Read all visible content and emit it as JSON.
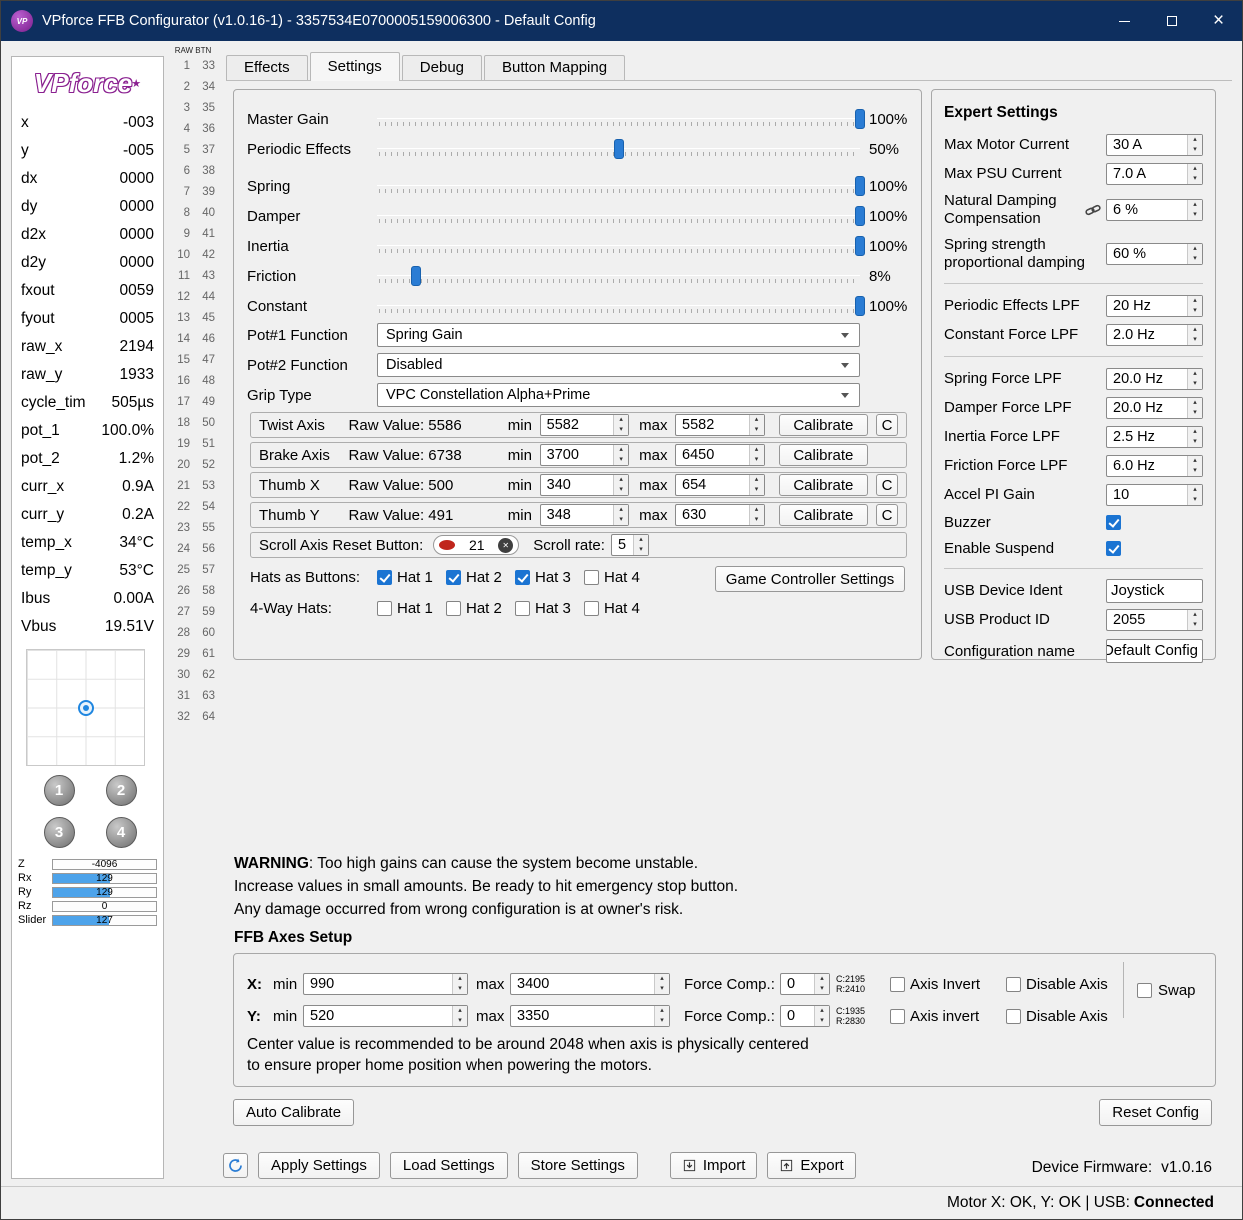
{
  "window": {
    "title": "VPforce FFB Configurator (v1.0.16-1) - 3357534E0700005159006300 - Default Config",
    "icon_text": "VP"
  },
  "colors": {
    "titlebar": "#0e2f5f",
    "accent": "#2a7cd4",
    "check": "#1b74d2",
    "barfill": "#4da3ea",
    "logo": "#8a2090",
    "red": "#c0251b"
  },
  "icons": {
    "close": "×",
    "star": "★",
    "clear": "✕",
    "spin_up": "▴",
    "spin_down": "▾"
  },
  "left_panel": {
    "logo_text": "VPforce",
    "telemetry": [
      {
        "label": "x",
        "value": "-003"
      },
      {
        "label": "y",
        "value": "-005"
      },
      {
        "label": "dx",
        "value": "0000"
      },
      {
        "label": "dy",
        "value": "0000"
      },
      {
        "label": "d2x",
        "value": "0000"
      },
      {
        "label": "d2y",
        "value": "0000"
      },
      {
        "label": "fxout",
        "value": "0059"
      },
      {
        "label": "fyout",
        "value": "0005"
      },
      {
        "label": "raw_x",
        "value": "2194"
      },
      {
        "label": "raw_y",
        "value": "1933"
      },
      {
        "label": "cycle_tim",
        "value": "505µs"
      },
      {
        "label": "pot_1",
        "value": "100.0%"
      },
      {
        "label": "pot_2",
        "value": "1.2%"
      },
      {
        "label": "curr_x",
        "value": "0.9A"
      },
      {
        "label": "curr_y",
        "value": "0.2A"
      },
      {
        "label": "temp_x",
        "value": "34°C"
      },
      {
        "label": "temp_y",
        "value": "53°C"
      },
      {
        "label": "Ibus",
        "value": "0.00A"
      },
      {
        "label": "Vbus",
        "value": "19.51V"
      }
    ],
    "stick_buttons": [
      "1",
      "2",
      "3",
      "4"
    ],
    "axis_bars": [
      {
        "label": "Z",
        "value": "-4096",
        "pct": 0
      },
      {
        "label": "Rx",
        "value": "129",
        "pct": 55
      },
      {
        "label": "Ry",
        "value": "129",
        "pct": 55
      },
      {
        "label": "Rz",
        "value": "0",
        "pct": 0
      },
      {
        "label": "Slider",
        "value": "127",
        "pct": 54
      }
    ]
  },
  "raw_btn": {
    "header": "RAW BTN",
    "rows": [
      {
        "l": "1",
        "r": "33"
      },
      {
        "l": "2",
        "r": "34"
      },
      {
        "l": "3",
        "r": "35"
      },
      {
        "l": "4",
        "r": "36"
      },
      {
        "l": "5",
        "r": "37"
      },
      {
        "l": "6",
        "r": "38"
      },
      {
        "l": "7",
        "r": "39"
      },
      {
        "l": "8",
        "r": "40"
      },
      {
        "l": "9",
        "r": "41"
      },
      {
        "l": "10",
        "r": "42"
      },
      {
        "l": "11",
        "r": "43"
      },
      {
        "l": "12",
        "r": "44"
      },
      {
        "l": "13",
        "r": "45"
      },
      {
        "l": "14",
        "r": "46"
      },
      {
        "l": "15",
        "r": "47"
      },
      {
        "l": "16",
        "r": "48"
      },
      {
        "l": "17",
        "r": "49"
      },
      {
        "l": "18",
        "r": "50"
      },
      {
        "l": "19",
        "r": "51"
      },
      {
        "l": "20",
        "r": "52"
      },
      {
        "l": "21",
        "r": "53"
      },
      {
        "l": "22",
        "r": "54"
      },
      {
        "l": "23",
        "r": "55"
      },
      {
        "l": "24",
        "r": "56"
      },
      {
        "l": "25",
        "r": "57"
      },
      {
        "l": "26",
        "r": "58"
      },
      {
        "l": "27",
        "r": "59"
      },
      {
        "l": "28",
        "r": "60"
      },
      {
        "l": "29",
        "r": "61"
      },
      {
        "l": "30",
        "r": "62"
      },
      {
        "l": "31",
        "r": "63"
      },
      {
        "l": "32",
        "r": "64"
      }
    ]
  },
  "tabs": {
    "effects": "Effects",
    "settings": "Settings",
    "debug": "Debug",
    "button_mapping": "Button Mapping"
  },
  "settings": {
    "sliders": [
      {
        "label": "Master Gain",
        "value": "100%",
        "pct": 100
      },
      {
        "label": "Periodic Effects",
        "value": "50%",
        "pct": 50
      },
      {
        "label": "Spring",
        "value": "100%",
        "pct": 100
      },
      {
        "label": "Damper",
        "value": "100%",
        "pct": 100
      },
      {
        "label": "Inertia",
        "value": "100%",
        "pct": 100
      },
      {
        "label": "Friction",
        "value": "8%",
        "pct": 8
      },
      {
        "label": "Constant",
        "value": "100%",
        "pct": 100
      }
    ],
    "pot1_label": "Pot#1 Function",
    "pot1_value": "Spring Gain",
    "pot2_label": "Pot#2 Function",
    "pot2_value": "Disabled",
    "grip_label": "Grip Type",
    "grip_value": "VPC Constellation Alpha+Prime",
    "min_label": "min",
    "max_label": "max",
    "calibrate_label": "Calibrate",
    "c_label": "C",
    "axes": [
      {
        "name": "Twist Axis",
        "raw": "Raw Value: 5586",
        "min": "5582",
        "max": "5582",
        "has_c": true
      },
      {
        "name": "Brake Axis",
        "raw": "Raw Value: 6738",
        "min": "3700",
        "max": "6450",
        "has_c": false
      },
      {
        "name": "Thumb X",
        "raw": "Raw Value: 500",
        "min": "340",
        "max": "654",
        "has_c": true
      },
      {
        "name": "Thumb Y",
        "raw": "Raw Value: 491",
        "min": "348",
        "max": "630",
        "has_c": true
      }
    ],
    "scroll": {
      "label": "Scroll Axis Reset Button:",
      "value": "21",
      "rate_label": "Scroll rate:",
      "rate": "5"
    },
    "hats_buttons_label": "Hats as Buttons:",
    "hats_buttons": [
      {
        "label": "Hat 1",
        "checked": true
      },
      {
        "label": "Hat 2",
        "checked": true
      },
      {
        "label": "Hat 3",
        "checked": true
      },
      {
        "label": "Hat 4",
        "checked": false
      }
    ],
    "four_way_label": "4-Way Hats:",
    "four_way": [
      {
        "label": "Hat 1",
        "checked": false
      },
      {
        "label": "Hat 2",
        "checked": false
      },
      {
        "label": "Hat 3",
        "checked": false
      },
      {
        "label": "Hat 4",
        "checked": false
      }
    ],
    "game_controller_button": "Game Controller Settings"
  },
  "expert": {
    "title": "Expert Settings",
    "current_rows": [
      {
        "label": "Max Motor Current",
        "value": "30 A"
      },
      {
        "label": "Max PSU Current",
        "value": "7.0 A"
      }
    ],
    "nat_damp": {
      "label1": "Natural Damping",
      "label2": "Compensation",
      "value": "6 %"
    },
    "spring_prop": {
      "label1": "Spring strength",
      "label2": "proportional damping",
      "value": "60 %"
    },
    "lpf_rows1": [
      {
        "label": "Periodic Effects LPF",
        "value": "20 Hz"
      },
      {
        "label": "Constant Force LPF",
        "value": "2.0 Hz"
      }
    ],
    "lpf_rows2": [
      {
        "label": "Spring Force LPF",
        "value": "20.0 Hz"
      },
      {
        "label": "Damper Force LPF",
        "value": "20.0 Hz"
      },
      {
        "label": "Inertia Force LPF",
        "value": "2.5 Hz"
      },
      {
        "label": "Friction Force LPF",
        "value": "6.0 Hz"
      },
      {
        "label": "Accel PI Gain",
        "value": "10"
      }
    ],
    "buzzer_label": "Buzzer",
    "suspend_label": "Enable Suspend",
    "usb_ident_label": "USB Device Ident",
    "usb_ident_value": "Joystick",
    "usb_pid_label": "USB Product ID",
    "usb_pid_value": "2055",
    "config_name_label": "Configuration name",
    "config_name_value": "Default Config"
  },
  "warning": {
    "bold": "WARNING",
    "line1": ": Too high gains can cause the system become unstable.",
    "line2": "Increase values in small amounts. Be ready to hit emergency stop button.",
    "line3": "Any damage occurred from wrong configuration is at owner's risk."
  },
  "ffb": {
    "title": "FFB Axes Setup",
    "rows": [
      {
        "axis": "X:",
        "min_label": "min",
        "min": "990",
        "max_label": "max",
        "max": "3400",
        "fc_label": "Force Comp.:",
        "fc": "0",
        "c": "C:2195",
        "r": "R:2410",
        "invert_label": "Axis Invert",
        "disable_label": "Disable Axis"
      },
      {
        "axis": "Y:",
        "min_label": "min",
        "min": "520",
        "max_label": "max",
        "max": "3350",
        "fc_label": "Force Comp.:",
        "fc": "0",
        "c": "C:1935",
        "r": "R:2830",
        "invert_label": "Axis invert",
        "disable_label": "Disable Axis"
      }
    ],
    "swap_label": "Swap",
    "note1": "Center value is recommended to be around 2048 when axis is physically centered",
    "note2": "to ensure proper home position when powering the motors."
  },
  "actions": {
    "auto_calibrate": "Auto Calibrate",
    "reset_config": "Reset Config",
    "apply": "Apply Settings",
    "load": "Load Settings",
    "store": "Store Settings",
    "import": "Import",
    "export": "Export"
  },
  "footer": {
    "firmware_label": "Device Firmware:",
    "firmware_value": "v1.0.16",
    "status_text": "Motor X: OK, Y: OK | USB: ",
    "status_value": "Connected"
  }
}
